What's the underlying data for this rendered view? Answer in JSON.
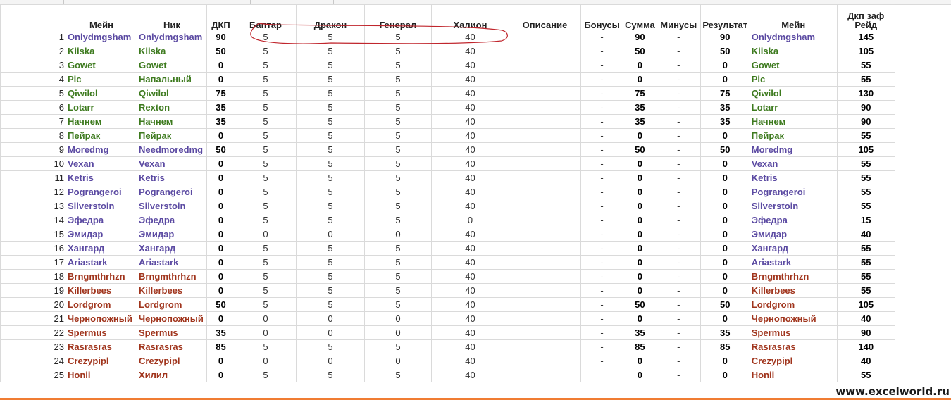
{
  "headers": {
    "main": "Мейн",
    "nick": "Ник",
    "dkp": "ДКП",
    "baptar": "Баптар",
    "drakon": "Дракон",
    "general": "Генерал",
    "halion": "Халион",
    "opisanie": "Описание",
    "bonusy": "Бонусы",
    "summa": "Сумма",
    "minusy": "Минусы",
    "rezultat": "Результат",
    "main2": "Мейн",
    "dkp_zaf_line1": "Дкп заф",
    "dkp_zaf_line2": "Рейд"
  },
  "colors": {
    "purple": "#5b4aa2",
    "green": "#3d7a1e",
    "red": "#a0341c",
    "annotation": "#c0262d",
    "orange_line": "#f07c33"
  },
  "rows": [
    {
      "n": "1",
      "main": "Onlydmgsham",
      "nick": "Onlydmgsham",
      "dkp": "90",
      "b": "5",
      "d": "5",
      "g": "5",
      "h": "40",
      "bonus": "-",
      "sum": "90",
      "minus": "-",
      "res": "90",
      "main2": "Onlydmgsham",
      "zaf": "145",
      "color": "purple"
    },
    {
      "n": "2",
      "main": "Kiiska",
      "nick": "Kiiska",
      "dkp": "50",
      "b": "5",
      "d": "5",
      "g": "5",
      "h": "40",
      "bonus": "-",
      "sum": "50",
      "minus": "-",
      "res": "50",
      "main2": "Kiiska",
      "zaf": "105",
      "color": "green"
    },
    {
      "n": "3",
      "main": "Gowet",
      "nick": "Gowet",
      "dkp": "0",
      "b": "5",
      "d": "5",
      "g": "5",
      "h": "40",
      "bonus": "-",
      "sum": "0",
      "minus": "-",
      "res": "0",
      "main2": "Gowet",
      "zaf": "55",
      "color": "green"
    },
    {
      "n": "4",
      "main": "Pic",
      "nick": "Напальный",
      "dkp": "0",
      "b": "5",
      "d": "5",
      "g": "5",
      "h": "40",
      "bonus": "-",
      "sum": "0",
      "minus": "-",
      "res": "0",
      "main2": "Pic",
      "zaf": "55",
      "color": "green"
    },
    {
      "n": "5",
      "main": "Qiwilol",
      "nick": "Qiwilol",
      "dkp": "75",
      "b": "5",
      "d": "5",
      "g": "5",
      "h": "40",
      "bonus": "-",
      "sum": "75",
      "minus": "-",
      "res": "75",
      "main2": "Qiwilol",
      "zaf": "130",
      "color": "green"
    },
    {
      "n": "6",
      "main": "Lotarr",
      "nick": "Rexton",
      "dkp": "35",
      "b": "5",
      "d": "5",
      "g": "5",
      "h": "40",
      "bonus": "-",
      "sum": "35",
      "minus": "-",
      "res": "35",
      "main2": "Lotarr",
      "zaf": "90",
      "color": "green"
    },
    {
      "n": "7",
      "main": "Начнем",
      "nick": "Начнем",
      "dkp": "35",
      "b": "5",
      "d": "5",
      "g": "5",
      "h": "40",
      "bonus": "-",
      "sum": "35",
      "minus": "-",
      "res": "35",
      "main2": "Начнем",
      "zaf": "90",
      "color": "green"
    },
    {
      "n": "8",
      "main": "Пейрак",
      "nick": "Пейрак",
      "dkp": "0",
      "b": "5",
      "d": "5",
      "g": "5",
      "h": "40",
      "bonus": "-",
      "sum": "0",
      "minus": "-",
      "res": "0",
      "main2": "Пейрак",
      "zaf": "55",
      "color": "green"
    },
    {
      "n": "9",
      "main": "Moredmg",
      "nick": "Needmoredmg",
      "dkp": "50",
      "b": "5",
      "d": "5",
      "g": "5",
      "h": "40",
      "bonus": "-",
      "sum": "50",
      "minus": "-",
      "res": "50",
      "main2": "Moredmg",
      "zaf": "105",
      "color": "purple"
    },
    {
      "n": "10",
      "main": "Vexan",
      "nick": "Vexan",
      "dkp": "0",
      "b": "5",
      "d": "5",
      "g": "5",
      "h": "40",
      "bonus": "-",
      "sum": "0",
      "minus": "-",
      "res": "0",
      "main2": "Vexan",
      "zaf": "55",
      "color": "purple"
    },
    {
      "n": "11",
      "main": "Ketris",
      "nick": "Ketris",
      "dkp": "0",
      "b": "5",
      "d": "5",
      "g": "5",
      "h": "40",
      "bonus": "-",
      "sum": "0",
      "minus": "-",
      "res": "0",
      "main2": "Ketris",
      "zaf": "55",
      "color": "purple"
    },
    {
      "n": "12",
      "main": "Pograngeroi",
      "nick": "Pograngeroi",
      "dkp": "0",
      "b": "5",
      "d": "5",
      "g": "5",
      "h": "40",
      "bonus": "-",
      "sum": "0",
      "minus": "-",
      "res": "0",
      "main2": "Pograngeroi",
      "zaf": "55",
      "color": "purple"
    },
    {
      "n": "13",
      "main": "Silverstoin",
      "nick": "Silverstoin",
      "dkp": "0",
      "b": "5",
      "d": "5",
      "g": "5",
      "h": "40",
      "bonus": "-",
      "sum": "0",
      "minus": "-",
      "res": "0",
      "main2": "Silverstoin",
      "zaf": "55",
      "color": "purple"
    },
    {
      "n": "14",
      "main": "Эфедра",
      "nick": "Эфедра",
      "dkp": "0",
      "b": "5",
      "d": "5",
      "g": "5",
      "h": "0",
      "bonus": "-",
      "sum": "0",
      "minus": "-",
      "res": "0",
      "main2": "Эфедра",
      "zaf": "15",
      "color": "purple"
    },
    {
      "n": "15",
      "main": "Эмидар",
      "nick": "Эмидар",
      "dkp": "0",
      "b": "0",
      "d": "0",
      "g": "0",
      "h": "40",
      "bonus": "-",
      "sum": "0",
      "minus": "-",
      "res": "0",
      "main2": "Эмидар",
      "zaf": "40",
      "color": "purple"
    },
    {
      "n": "16",
      "main": "Хангард",
      "nick": "Хангард",
      "dkp": "0",
      "b": "5",
      "d": "5",
      "g": "5",
      "h": "40",
      "bonus": "-",
      "sum": "0",
      "minus": "-",
      "res": "0",
      "main2": "Хангард",
      "zaf": "55",
      "color": "purple"
    },
    {
      "n": "17",
      "main": "Ariastark",
      "nick": "Ariastark",
      "dkp": "0",
      "b": "5",
      "d": "5",
      "g": "5",
      "h": "40",
      "bonus": "-",
      "sum": "0",
      "minus": "-",
      "res": "0",
      "main2": "Ariastark",
      "zaf": "55",
      "color": "purple"
    },
    {
      "n": "18",
      "main": "Brngmthrhzn",
      "nick": "Brngmthrhzn",
      "dkp": "0",
      "b": "5",
      "d": "5",
      "g": "5",
      "h": "40",
      "bonus": "-",
      "sum": "0",
      "minus": "-",
      "res": "0",
      "main2": "Brngmthrhzn",
      "zaf": "55",
      "color": "red"
    },
    {
      "n": "19",
      "main": "Killerbees",
      "nick": "Killerbees",
      "dkp": "0",
      "b": "5",
      "d": "5",
      "g": "5",
      "h": "40",
      "bonus": "-",
      "sum": "0",
      "minus": "-",
      "res": "0",
      "main2": "Killerbees",
      "zaf": "55",
      "color": "red"
    },
    {
      "n": "20",
      "main": "Lordgrom",
      "nick": "Lordgrom",
      "dkp": "50",
      "b": "5",
      "d": "5",
      "g": "5",
      "h": "40",
      "bonus": "-",
      "sum": "50",
      "minus": "-",
      "res": "50",
      "main2": "Lordgrom",
      "zaf": "105",
      "color": "red"
    },
    {
      "n": "21",
      "main": "Чернопожный",
      "nick": "Чернопожный",
      "dkp": "0",
      "b": "0",
      "d": "0",
      "g": "0",
      "h": "40",
      "bonus": "-",
      "sum": "0",
      "minus": "-",
      "res": "0",
      "main2": "Чернопожный",
      "zaf": "40",
      "color": "red"
    },
    {
      "n": "22",
      "main": "Spermus",
      "nick": "Spermus",
      "dkp": "35",
      "b": "0",
      "d": "0",
      "g": "0",
      "h": "40",
      "bonus": "-",
      "sum": "35",
      "minus": "-",
      "res": "35",
      "main2": "Spermus",
      "zaf": "90",
      "color": "red"
    },
    {
      "n": "23",
      "main": "Rasrasras",
      "nick": "Rasrasras",
      "dkp": "85",
      "b": "5",
      "d": "5",
      "g": "5",
      "h": "40",
      "bonus": "-",
      "sum": "85",
      "minus": "-",
      "res": "85",
      "main2": "Rasrasras",
      "zaf": "140",
      "color": "red"
    },
    {
      "n": "24",
      "main": "Crezypipl",
      "nick": "Crezypipl",
      "dkp": "0",
      "b": "0",
      "d": "0",
      "g": "0",
      "h": "40",
      "bonus": "-",
      "sum": "0",
      "minus": "-",
      "res": "0",
      "main2": "Crezypipl",
      "zaf": "40",
      "color": "red"
    },
    {
      "n": "25",
      "main": "Honii",
      "nick": "Хилил",
      "dkp": "0",
      "b": "5",
      "d": "5",
      "g": "5",
      "h": "40",
      "bonus": "",
      "sum": "0",
      "minus": "-",
      "res": "0",
      "main2": "Honii",
      "zaf": "55",
      "color": "red"
    }
  ],
  "watermark": "www.excelworld.ru"
}
